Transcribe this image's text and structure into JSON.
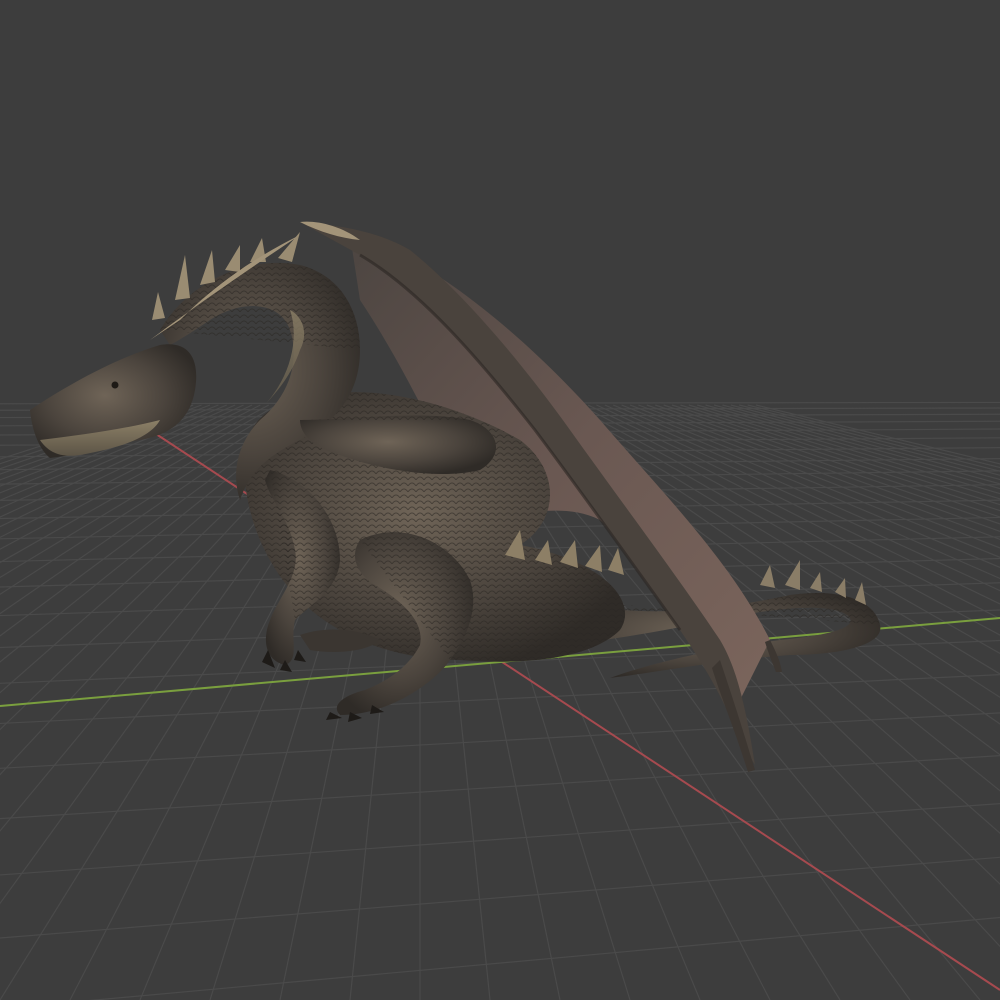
{
  "viewport": {
    "kind": "3d-viewport",
    "background": "#3d3d3d",
    "grid_color": "#4a4a4a",
    "x_axis_color": "#a64a4f",
    "y_axis_color": "#7a9f3e",
    "object_icon": "dragon-model"
  }
}
